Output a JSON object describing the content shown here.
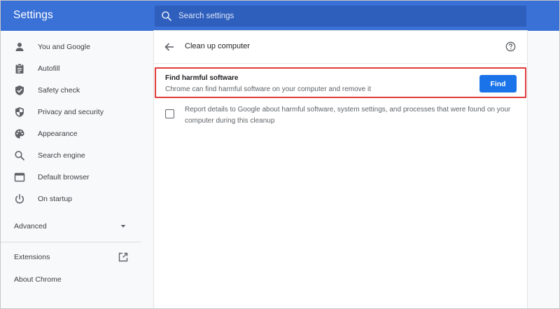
{
  "header": {
    "app_title": "Settings",
    "search_placeholder": "Search settings",
    "search_value": ""
  },
  "sidebar": {
    "items": [
      {
        "label": "You and Google",
        "icon": "person-icon"
      },
      {
        "label": "Autofill",
        "icon": "clipboard-icon"
      },
      {
        "label": "Safety check",
        "icon": "shield-check-icon"
      },
      {
        "label": "Privacy and security",
        "icon": "shield-icon"
      },
      {
        "label": "Appearance",
        "icon": "palette-icon"
      },
      {
        "label": "Search engine",
        "icon": "search-icon"
      },
      {
        "label": "Default browser",
        "icon": "browser-icon"
      },
      {
        "label": "On startup",
        "icon": "power-icon"
      }
    ],
    "advanced_label": "Advanced",
    "extensions_label": "Extensions",
    "about_label": "About Chrome"
  },
  "main": {
    "page_title": "Clean up computer",
    "find": {
      "title": "Find harmful software",
      "description": "Chrome can find harmful software on your computer and remove it",
      "button_label": "Find"
    },
    "report": {
      "checked": false,
      "text": "Report details to Google about harmful software, system settings, and processes that were found on your computer during this cleanup"
    }
  },
  "colors": {
    "topbar": "#3a71d6",
    "accent": "#1a73e8",
    "highlight": "#e23a3a"
  }
}
